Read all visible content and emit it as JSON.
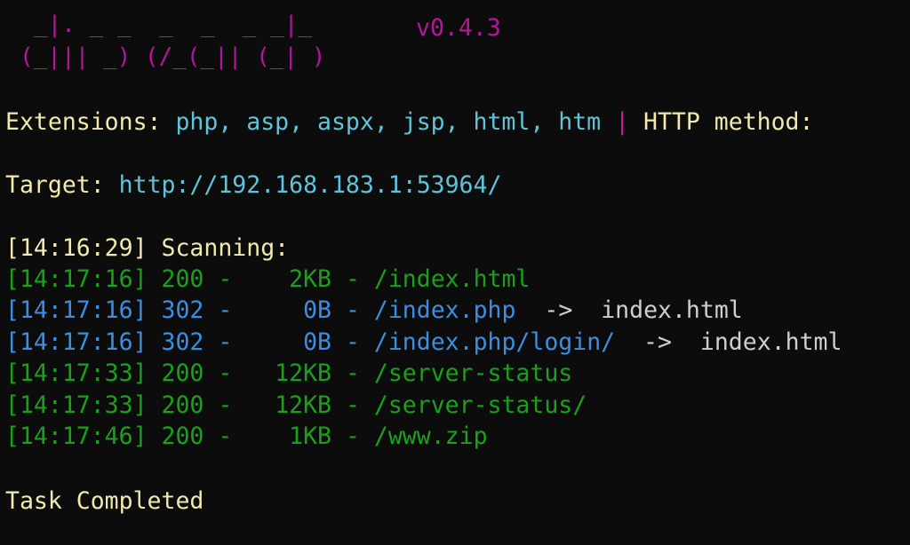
{
  "banner": {
    "line1": "_|. _ _  _  _  _ _|_",
    "line2": "(_||| _) (/_(_|| (_| )",
    "version": "v0.4.3"
  },
  "config": {
    "extensions_label": "Extensions:",
    "extensions_value": "php, asp, aspx, jsp, html, htm",
    "separator": "|",
    "method_label": "HTTP method:"
  },
  "target": {
    "label": "Target:",
    "url": "http://192.168.183.1:53964/"
  },
  "scan_start": {
    "time": "[14:16:29]",
    "label": "Scanning:"
  },
  "results": [
    {
      "time": "[14:17:16]",
      "status": "200",
      "size": "2KB",
      "path": "/index.html",
      "arrow": "",
      "redirect": "",
      "kind": "ok"
    },
    {
      "time": "[14:17:16]",
      "status": "302",
      "size": "0B",
      "path": "/index.php",
      "arrow": "->",
      "redirect": "index.html",
      "kind": "redirect"
    },
    {
      "time": "[14:17:16]",
      "status": "302",
      "size": "0B",
      "path": "/index.php/login/",
      "arrow": "->",
      "redirect": "index.html",
      "kind": "redirect"
    },
    {
      "time": "[14:17:33]",
      "status": "200",
      "size": "12KB",
      "path": "/server-status",
      "arrow": "",
      "redirect": "",
      "kind": "ok"
    },
    {
      "time": "[14:17:33]",
      "status": "200",
      "size": "12KB",
      "path": "/server-status/",
      "arrow": "",
      "redirect": "",
      "kind": "ok"
    },
    {
      "time": "[14:17:46]",
      "status": "200",
      "size": "1KB",
      "path": "/www.zip",
      "arrow": "",
      "redirect": "",
      "kind": "ok"
    }
  ],
  "footer": {
    "completed": "Task Completed"
  },
  "colors": {
    "background": "#0c0c0c",
    "banner": "#b5169b",
    "label": "#f1e9b0",
    "value": "#60c4d8",
    "status_200": "#19a11a",
    "status_302": "#3c8ee0",
    "redirect_target": "#cfcfcf"
  }
}
